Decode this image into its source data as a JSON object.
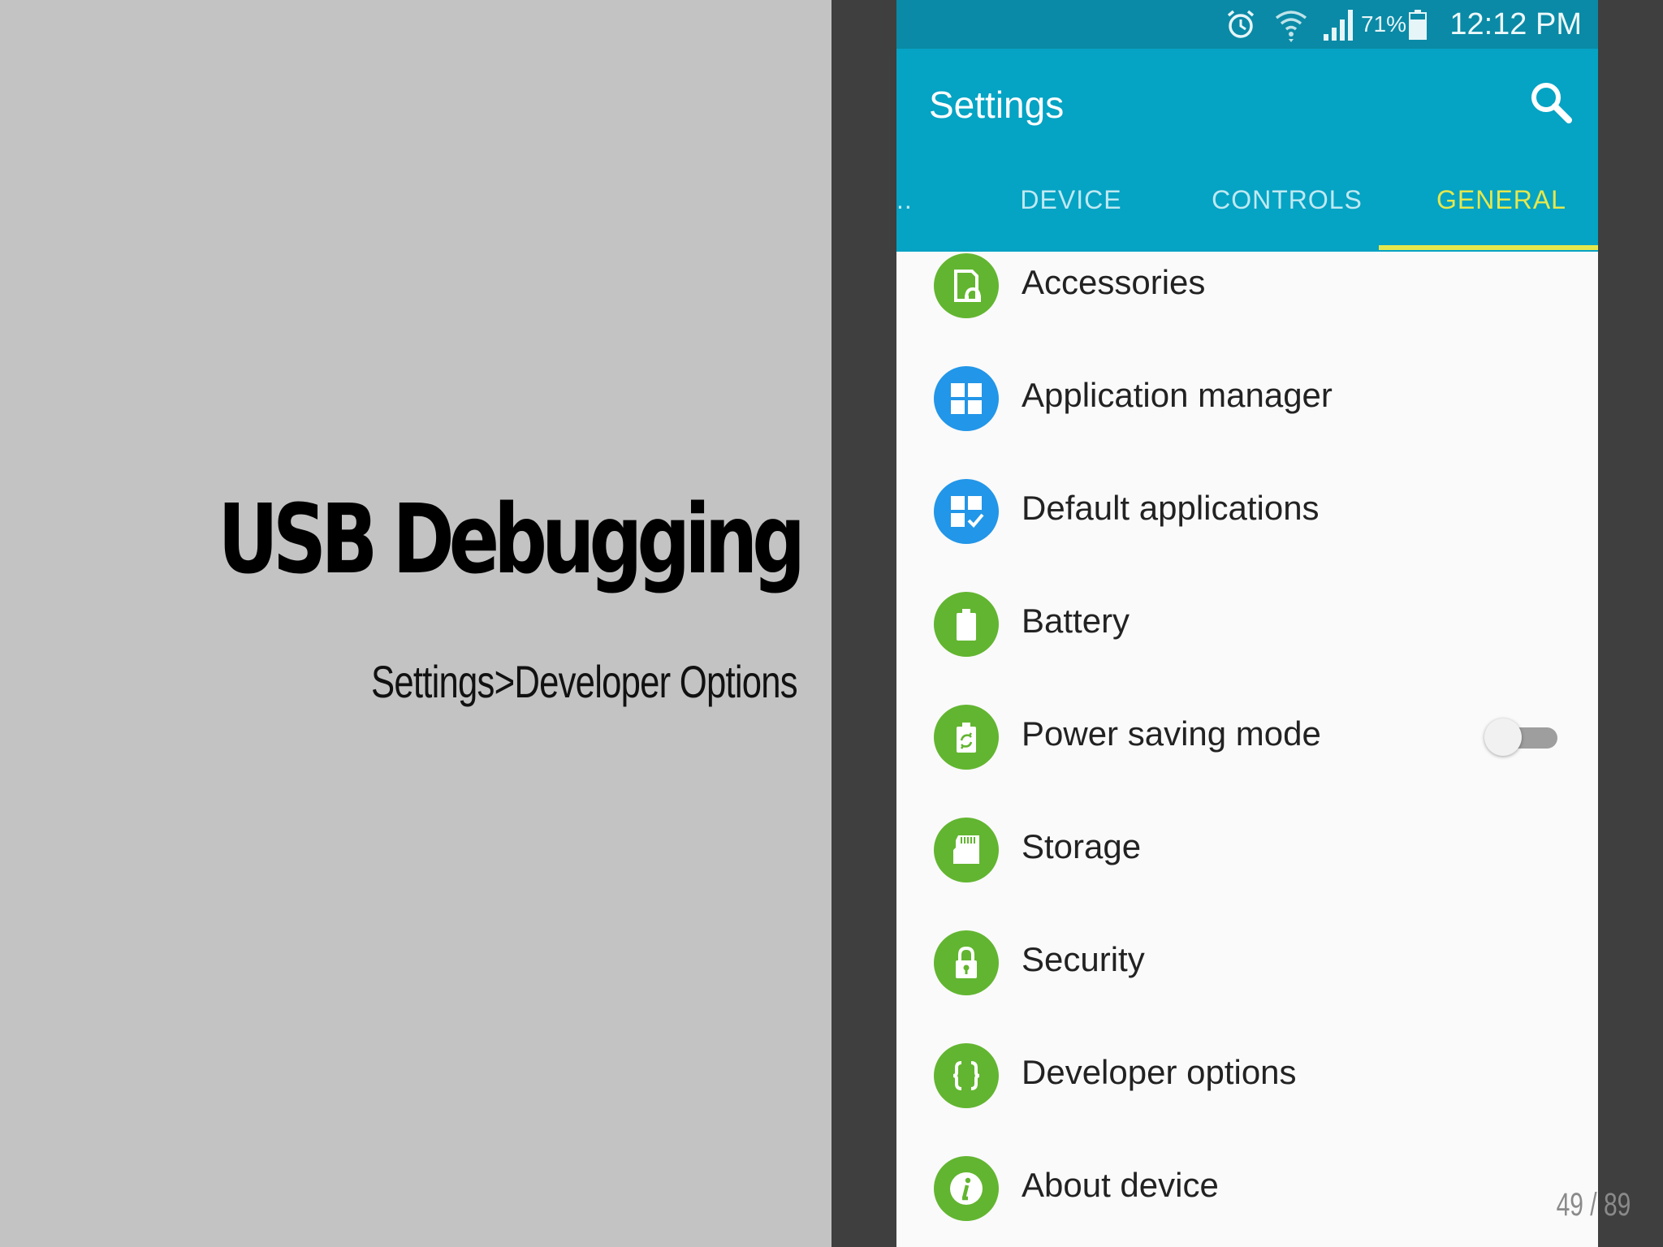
{
  "slide": {
    "title": "USB Debugging",
    "subtitle": "Settings>Developer Options",
    "page_number": "49 / 89"
  },
  "status_bar": {
    "battery_percent": "71%",
    "time": "12:12 PM",
    "icons": [
      "alarm-icon",
      "wifi-icon",
      "signal-icon",
      "battery-icon"
    ]
  },
  "app_bar": {
    "title": "Settings",
    "search_icon": "search-icon",
    "background": "#05a3c4"
  },
  "tabs": {
    "overflow": "..",
    "device": "DEVICE",
    "controls": "CONTROLS",
    "general": "GENERAL",
    "selected": "GENERAL",
    "indicator_color": "#e5e84d"
  },
  "settings_items": [
    {
      "label": "Accessories",
      "icon": "accessories-icon",
      "color": "#62b530"
    },
    {
      "label": "Application manager",
      "icon": "app-grid-icon",
      "color": "#2296e8"
    },
    {
      "label": "Default applications",
      "icon": "default-apps-icon",
      "color": "#2296e8"
    },
    {
      "label": "Battery",
      "icon": "battery-icon",
      "color": "#62b530"
    },
    {
      "label": "Power saving mode",
      "icon": "power-saving-icon",
      "color": "#62b530",
      "toggle": "off"
    },
    {
      "label": "Storage",
      "icon": "sd-card-icon",
      "color": "#62b530"
    },
    {
      "label": "Security",
      "icon": "lock-icon",
      "color": "#62b530"
    },
    {
      "label": "Developer options",
      "icon": "braces-icon",
      "color": "#62b530"
    },
    {
      "label": "About device",
      "icon": "info-icon",
      "color": "#62b530"
    }
  ]
}
